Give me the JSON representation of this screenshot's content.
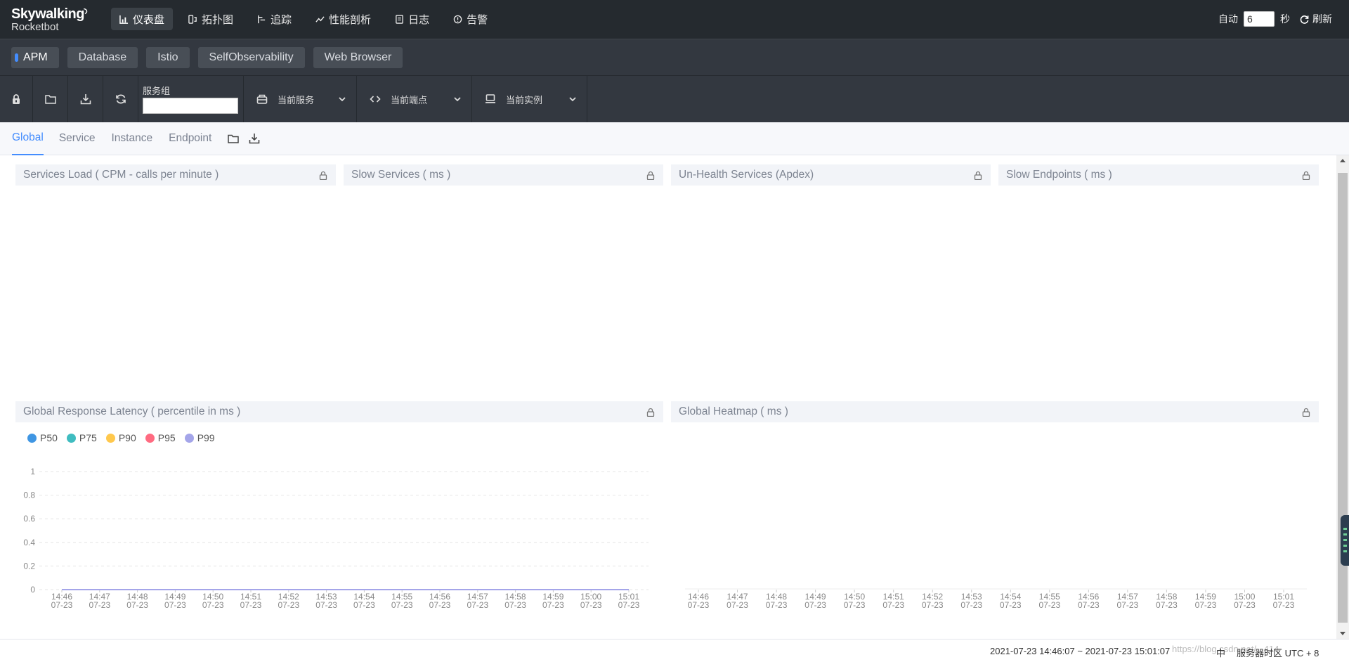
{
  "brand": {
    "name": "Skywalking",
    "sub": "Rocketbot"
  },
  "nav": [
    {
      "label": "仪表盘",
      "icon": "bar-chart-icon",
      "active": true
    },
    {
      "label": "拓扑图",
      "icon": "topology-icon",
      "active": false
    },
    {
      "label": "追踪",
      "icon": "trace-icon",
      "active": false
    },
    {
      "label": "性能剖析",
      "icon": "profile-icon",
      "active": false
    },
    {
      "label": "日志",
      "icon": "log-icon",
      "active": false
    },
    {
      "label": "告警",
      "icon": "alarm-icon",
      "active": false
    }
  ],
  "top_right": {
    "auto_label": "自动",
    "auto_value": "6",
    "unit": "秒",
    "refresh_label": "刷新"
  },
  "dashboard_tabs": [
    "APM",
    "Database",
    "Istio",
    "SelfObservability",
    "Web Browser"
  ],
  "toolbar": {
    "group_label": "服务组",
    "group_value": "",
    "service_label": "当前服务",
    "endpoint_label": "当前端点",
    "instance_label": "当前实例"
  },
  "sub_tabs": [
    "Global",
    "Service",
    "Instance",
    "Endpoint"
  ],
  "panels": {
    "services_load": "Services Load ( CPM - calls per minute )",
    "slow_services": "Slow Services ( ms )",
    "unhealth_services": "Un-Health Services (Apdex)",
    "slow_endpoints": "Slow Endpoints ( ms )",
    "global_latency": "Global Response Latency ( percentile in ms )",
    "global_heatmap": "Global Heatmap ( ms )"
  },
  "colors": {
    "accent": "#448dfe",
    "nav_bg": "#252a2f",
    "bar_bg": "#333840"
  },
  "chart_data": [
    {
      "type": "line",
      "title": "Global Response Latency ( percentile in ms )",
      "categories": [
        "14:46\n07-23",
        "14:47\n07-23",
        "14:48\n07-23",
        "14:49\n07-23",
        "14:50\n07-23",
        "14:51\n07-23",
        "14:52\n07-23",
        "14:53\n07-23",
        "14:54\n07-23",
        "14:55\n07-23",
        "14:56\n07-23",
        "14:57\n07-23",
        "14:58\n07-23",
        "14:59\n07-23",
        "15:00\n07-23",
        "15:01\n07-23"
      ],
      "series": [
        {
          "name": "P50",
          "color": "#3f96e3",
          "values": [
            0,
            0,
            0,
            0,
            0,
            0,
            0,
            0,
            0,
            0,
            0,
            0,
            0,
            0,
            0,
            0
          ]
        },
        {
          "name": "P75",
          "color": "#3fbcc0",
          "values": [
            0,
            0,
            0,
            0,
            0,
            0,
            0,
            0,
            0,
            0,
            0,
            0,
            0,
            0,
            0,
            0
          ]
        },
        {
          "name": "P90",
          "color": "#ffc84c",
          "values": [
            0,
            0,
            0,
            0,
            0,
            0,
            0,
            0,
            0,
            0,
            0,
            0,
            0,
            0,
            0,
            0
          ]
        },
        {
          "name": "P95",
          "color": "#ff6b81",
          "values": [
            0,
            0,
            0,
            0,
            0,
            0,
            0,
            0,
            0,
            0,
            0,
            0,
            0,
            0,
            0,
            0
          ]
        },
        {
          "name": "P99",
          "color": "#a4a5e9",
          "values": [
            0,
            0,
            0,
            0,
            0,
            0,
            0,
            0,
            0,
            0,
            0,
            0,
            0,
            0,
            0,
            0
          ]
        }
      ],
      "yticks": [
        "1",
        "0.8",
        "0.6",
        "0.4",
        "0.2",
        "0"
      ],
      "ylim": [
        0,
        1
      ],
      "legend": "top-left",
      "grid": true
    },
    {
      "type": "heatmap",
      "title": "Global Heatmap ( ms )",
      "categories": [
        "14:46\n07-23",
        "14:47\n07-23",
        "14:48\n07-23",
        "14:49\n07-23",
        "14:50\n07-23",
        "14:51\n07-23",
        "14:52\n07-23",
        "14:53\n07-23",
        "14:54\n07-23",
        "14:55\n07-23",
        "14:56\n07-23",
        "14:57\n07-23",
        "14:58\n07-23",
        "14:59\n07-23",
        "15:00\n07-23",
        "15:01\n07-23"
      ],
      "values": []
    }
  ],
  "footer": {
    "time_range": "2021-07-23 14:46:07 ~ 2021-07-23 15:01:07",
    "lang": "中",
    "timezone": "服务器时区 UTC + 8",
    "watermark": "https://blog.csdn.net/...414"
  }
}
